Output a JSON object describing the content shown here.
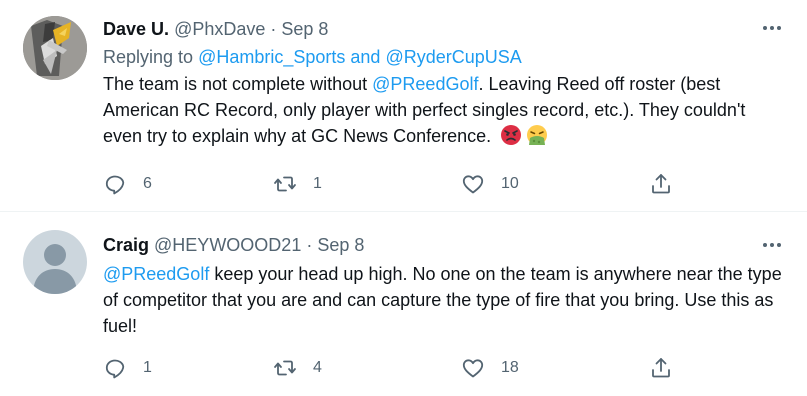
{
  "tweets": [
    {
      "name": "Dave U.",
      "handle": "@PhxDave",
      "separator": "·",
      "date": "Sep 8",
      "more_icon": "more-horizontal-icon",
      "replying_prefix": "Replying to ",
      "replying_user1": "@Hambric_Sports",
      "replying_and": " and ",
      "replying_user2": "@RyderCupUSA",
      "body_pre": "The team is not complete without ",
      "body_mention": "@PReedGolf",
      "body_post": ". Leaving Reed off roster (best American RC Record, only player with perfect singles record, etc.). They couldn't even try to explain why at GC News Conference.",
      "emojis": [
        "angry-face-emoji",
        "vomiting-face-emoji"
      ],
      "replies": "6",
      "retweets": "1",
      "likes": "10"
    },
    {
      "name": "Craig",
      "handle": "@HEYWOOOD21",
      "separator": "·",
      "date": "Sep 8",
      "more_icon": "more-horizontal-icon",
      "body_mention": "@PReedGolf",
      "body_post": " keep your head up high. No one on the team is anywhere near the type of competitor that you are and can capture the type of fire that you bring. Use this as fuel!",
      "replies": "1",
      "retweets": "4",
      "likes": "18"
    }
  ],
  "colors": {
    "link": "#1d9bf0",
    "secondary_text": "#536471",
    "primary_text": "#0f1419",
    "divider": "#eff3f4"
  }
}
